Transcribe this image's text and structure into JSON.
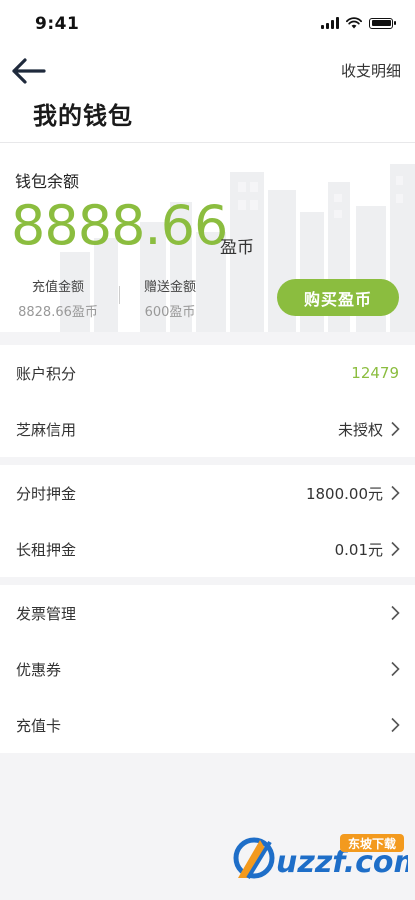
{
  "status_bar": {
    "time": "9:41"
  },
  "header": {
    "back_icon": "arrow-left-icon",
    "detail_link": "收支明细",
    "title": "我的钱包"
  },
  "wallet": {
    "label": "钱包余额",
    "balance": "8888.66",
    "unit": "盈币",
    "recharge_label": "充值金额",
    "recharge_value": "8828.66盈币",
    "gift_label": "赠送金额",
    "gift_value": "600盈币",
    "buy_button": "购买盈币",
    "accent_color": "#8bbd3f"
  },
  "groups": [
    {
      "rows": [
        {
          "label": "账户积分",
          "value": "12479",
          "chevron": false,
          "highlight": true
        },
        {
          "label": "芝麻信用",
          "value": "未授权",
          "chevron": true
        }
      ]
    },
    {
      "rows": [
        {
          "label": "分时押金",
          "value": "1800.00元",
          "chevron": true
        },
        {
          "label": "长租押金",
          "value": "0.01元",
          "chevron": true
        }
      ]
    },
    {
      "rows": [
        {
          "label": "发票管理",
          "value": "",
          "chevron": true
        },
        {
          "label": "优惠券",
          "value": "",
          "chevron": true
        },
        {
          "label": "充值卡",
          "value": "",
          "chevron": true
        }
      ]
    }
  ],
  "watermark": {
    "brand": "uzzf.com",
    "tag": "东坡下载"
  }
}
